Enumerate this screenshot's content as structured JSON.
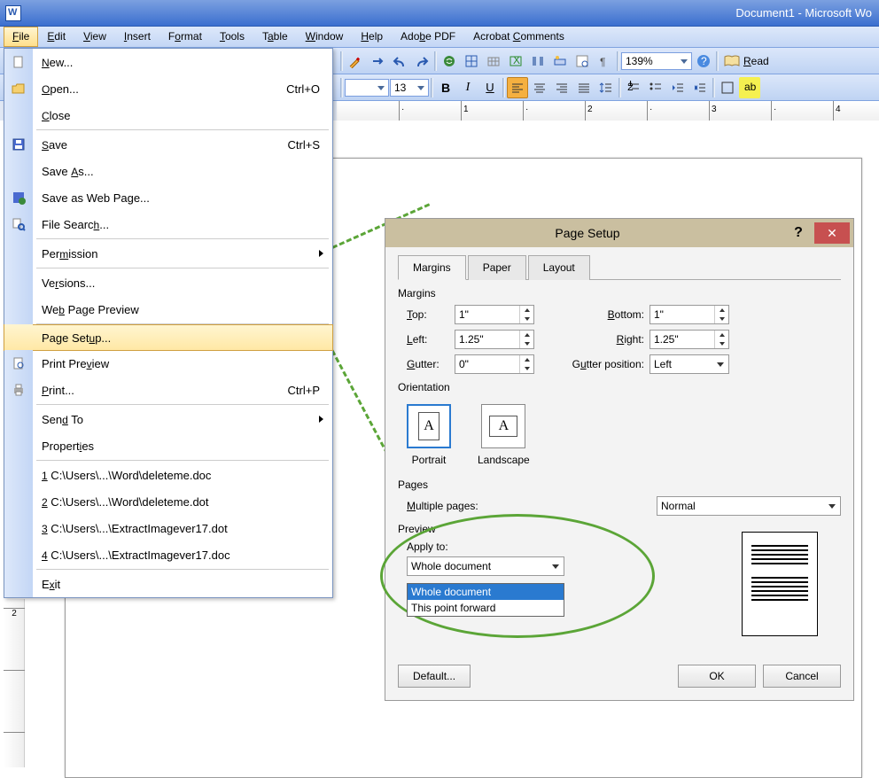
{
  "window_title": "Document1 - Microsoft Wo",
  "menubar": [
    "File",
    "Edit",
    "View",
    "Insert",
    "Format",
    "Tools",
    "Table",
    "Window",
    "Help",
    "Adobe PDF",
    "Acrobat Comments"
  ],
  "menubar_uline": [
    "F",
    "E",
    "V",
    "I",
    "o",
    "T",
    "a",
    "W",
    "H",
    "",
    ""
  ],
  "toolbar1": {
    "zoom": "139%",
    "read": "Read"
  },
  "toolbar2": {
    "font_size": "13"
  },
  "ruler_marks": [
    "1",
    "2",
    "3",
    "4"
  ],
  "vruler_marks": [
    "2"
  ],
  "file_menu": [
    {
      "label": "New...",
      "mn": "N",
      "icon": "new"
    },
    {
      "label": "Open...",
      "mn": "O",
      "short": "Ctrl+O",
      "icon": "open"
    },
    {
      "label": "Close",
      "mn": "C"
    },
    {
      "sep": true
    },
    {
      "label": "Save",
      "mn": "S",
      "short": "Ctrl+S",
      "icon": "save"
    },
    {
      "label": "Save As...",
      "mn": "A"
    },
    {
      "label": "Save as Web Page...",
      "icon": "saveweb"
    },
    {
      "label": "File Search...",
      "mn": "h",
      "icon": "search"
    },
    {
      "sep": true
    },
    {
      "label": "Permission",
      "mn": "m",
      "arrow": true
    },
    {
      "sep": true
    },
    {
      "label": "Versions...",
      "mn": "r"
    },
    {
      "label": "Web Page Preview",
      "mn": "b"
    },
    {
      "sep": true
    },
    {
      "label": "Page Setup...",
      "mn": "u",
      "hl": true
    },
    {
      "label": "Print Preview",
      "mn": "v",
      "icon": "preview"
    },
    {
      "label": "Print...",
      "mn": "P",
      "short": "Ctrl+P",
      "icon": "print"
    },
    {
      "sep": true
    },
    {
      "label": "Send To",
      "mn": "d",
      "arrow": true
    },
    {
      "label": "Properties",
      "mn": "i"
    },
    {
      "sep": true
    },
    {
      "label": "1 C:\\Users\\...\\Word\\deleteme.doc",
      "mn": "1"
    },
    {
      "label": "2 C:\\Users\\...\\Word\\deleteme.dot",
      "mn": "2"
    },
    {
      "label": "3 C:\\Users\\...\\ExtractImagever17.dot",
      "mn": "3"
    },
    {
      "label": "4 C:\\Users\\...\\ExtractImagever17.doc",
      "mn": "4"
    },
    {
      "sep": true
    },
    {
      "label": "Exit",
      "mn": "x"
    }
  ],
  "dialog": {
    "title": "Page Setup",
    "tabs": [
      "Margins",
      "Paper",
      "Layout"
    ],
    "active_tab": 0,
    "margins_label": "Margins",
    "top_label": "Top:",
    "top_value": "1\"",
    "bottom_label": "Bottom:",
    "bottom_value": "1\"",
    "left_label": "Left:",
    "left_value": "1.25\"",
    "right_label": "Right:",
    "right_value": "1.25\"",
    "gutter_label": "Gutter:",
    "gutter_value": "0\"",
    "gutter_pos_label": "Gutter position:",
    "gutter_pos_value": "Left",
    "orientation_label": "Orientation",
    "portrait": "Portrait",
    "landscape": "Landscape",
    "pages_label": "Pages",
    "multiple_pages_label": "Multiple pages:",
    "multiple_pages_value": "Normal",
    "preview_label": "Preview",
    "apply_to_label": "Apply to:",
    "apply_to_value": "Whole document",
    "apply_to_options": [
      "Whole document",
      "This point forward"
    ],
    "default_btn": "Default...",
    "ok_btn": "OK",
    "cancel_btn": "Cancel"
  }
}
